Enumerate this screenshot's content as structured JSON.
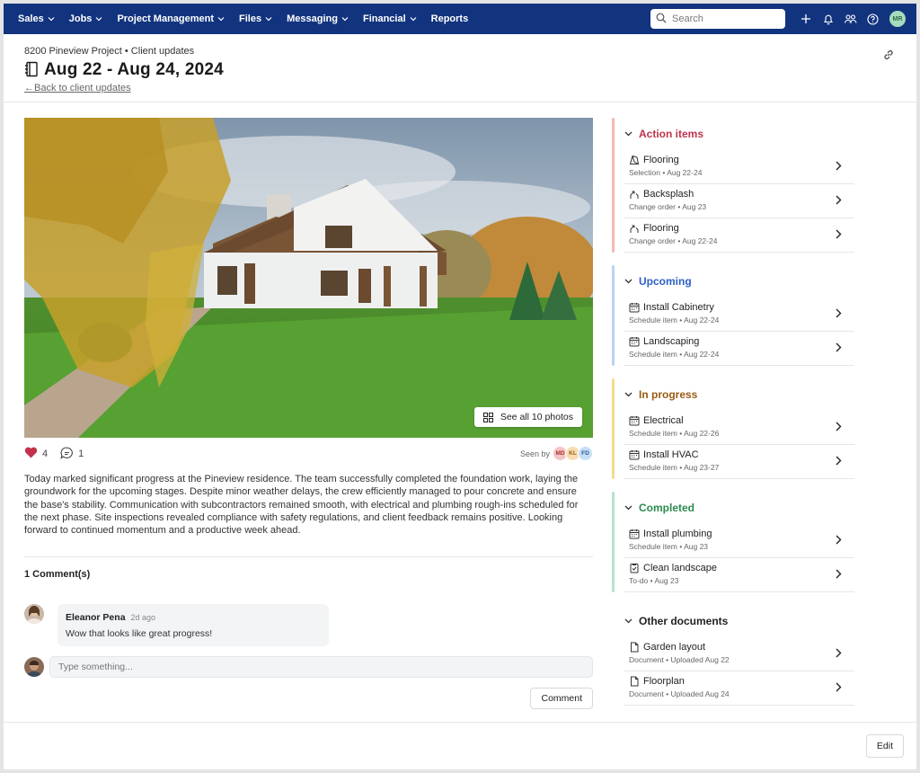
{
  "nav": {
    "items": [
      {
        "label": "Sales",
        "dropdown": true
      },
      {
        "label": "Jobs",
        "dropdown": true
      },
      {
        "label": "Project Management",
        "dropdown": true
      },
      {
        "label": "Files",
        "dropdown": true
      },
      {
        "label": "Messaging",
        "dropdown": true
      },
      {
        "label": "Financial",
        "dropdown": true
      },
      {
        "label": "Reports",
        "dropdown": false
      }
    ],
    "search_placeholder": "Search",
    "user_initials": "MR",
    "bg_color": "#12347f"
  },
  "header": {
    "breadcrumb": "8200 Pineview Project • Client updates",
    "title": "Aug 22 - Aug 24, 2024",
    "back_link": "←Back to client updates"
  },
  "post": {
    "see_all_label": "See all 10 photos",
    "likes": "4",
    "comment_count": "1",
    "seen_by_label": "Seen by",
    "seen_by": [
      {
        "initials": "MD",
        "bg": "#f5c4c4",
        "fg": "#a33"
      },
      {
        "initials": "KL",
        "bg": "#f8ddb2",
        "fg": "#9a5a12"
      },
      {
        "initials": "FD",
        "bg": "#c7def7",
        "fg": "#2d5f9a"
      }
    ],
    "body": "Today marked significant progress at the Pineview residence. The team successfully completed the foundation work, laying the groundwork for the upcoming stages. Despite minor weather delays, the crew efficiently managed to pour concrete and ensure the base's stability. Communication with subcontractors remained smooth, with electrical and plumbing rough-ins scheduled for the next phase. Site inspections revealed compliance with safety regulations, and client feedback remains positive. Looking forward to continued momentum and a productive week ahead."
  },
  "comments": {
    "title": "1 Comment(s)",
    "items": [
      {
        "name": "Eleanor Pena",
        "time": "2d ago",
        "text": "Wow that looks like great progress!"
      }
    ],
    "input_placeholder": "Type something...",
    "submit_label": "Comment"
  },
  "sidebar": {
    "sections": [
      {
        "title": "Action items",
        "color": "#c0334d",
        "bar": "#f4b9b0",
        "items": [
          {
            "icon": "selection-icon",
            "label": "Flooring",
            "sub": "Selection • Aug 22-24"
          },
          {
            "icon": "change-order-icon",
            "label": "Backsplash",
            "sub": "Change order • Aug 23"
          },
          {
            "icon": "change-order-icon",
            "label": "Flooring",
            "sub": "Change order • Aug 22-24"
          }
        ]
      },
      {
        "title": "Upcoming",
        "color": "#2f5fc4",
        "bar": "#b9d3f2",
        "items": [
          {
            "icon": "calendar-icon",
            "label": "Install Cabinetry",
            "sub": "Schedule item • Aug 22-24"
          },
          {
            "icon": "calendar-icon",
            "label": "Landscaping",
            "sub": "Schedule item • Aug 22-24"
          }
        ]
      },
      {
        "title": "In progress",
        "color": "#9a5a12",
        "bar": "#f2dc8f",
        "items": [
          {
            "icon": "calendar-icon",
            "label": "Electrical",
            "sub": "Schedule item • Aug 22-26"
          },
          {
            "icon": "calendar-icon",
            "label": "Install HVAC",
            "sub": "Schedule item • Aug 23-27"
          }
        ]
      },
      {
        "title": "Completed",
        "color": "#2e8a4e",
        "bar": "#b6e3c9",
        "items": [
          {
            "icon": "calendar-icon",
            "label": "Install plumbing",
            "sub": "Schedule item • Aug 23"
          },
          {
            "icon": "todo-icon",
            "label": "Clean landscape",
            "sub": "To-do • Aug 23"
          }
        ]
      },
      {
        "title": "Other documents",
        "color": "#222222",
        "bar": "",
        "items": [
          {
            "icon": "document-icon",
            "label": "Garden layout",
            "sub": "Document • Uploaded Aug 22"
          },
          {
            "icon": "document-icon",
            "label": "Floorplan",
            "sub": "Document • Uploaded Aug 24"
          }
        ]
      }
    ]
  },
  "footer": {
    "edit_label": "Edit"
  }
}
